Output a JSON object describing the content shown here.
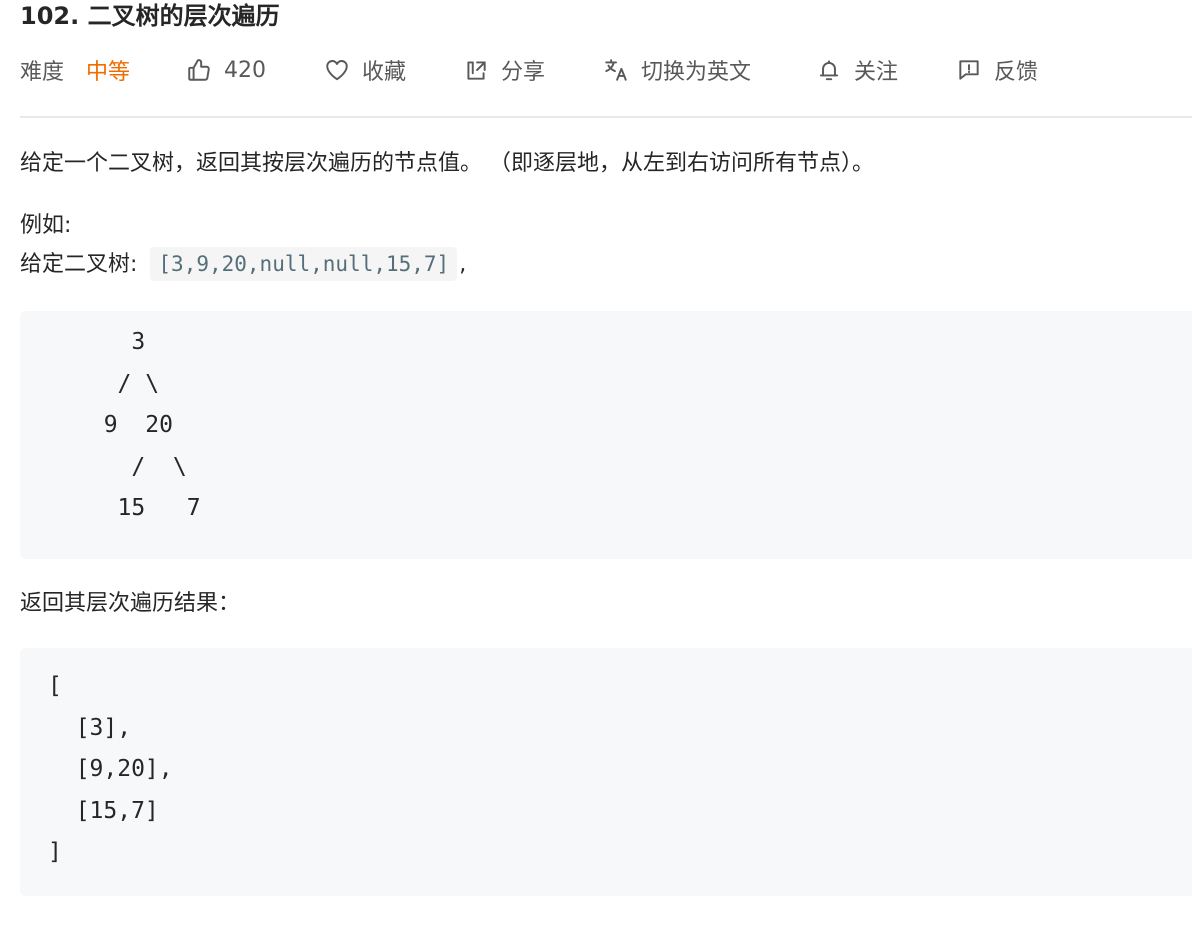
{
  "problem": {
    "title": "102. 二叉树的层次遍历"
  },
  "toolbar": {
    "difficulty_label": "难度",
    "difficulty_value": "中等",
    "likes_count": "420",
    "favorite_label": "收藏",
    "share_label": "分享",
    "translate_label": "切换为英文",
    "follow_label": "关注",
    "feedback_label": "反馈"
  },
  "description": {
    "intro": "给定一个二叉树，返回其按层次遍历的节点值。 （即逐层地，从左到右访问所有节点）。",
    "example_heading": "例如:",
    "given_prefix": "给定二叉树: ",
    "given_code": "[3,9,20,null,null,15,7]",
    "given_suffix": ",",
    "tree_diagram": "    3\n   / \\\n  9  20\n    /  \\\n   15   7",
    "result_heading": "返回其层次遍历结果：",
    "result_code": "[\n  [3],\n  [9,20],\n  [15,7]\n]"
  },
  "colors": {
    "difficulty_medium": "#ef6c00",
    "code_background": "#f7f8fa",
    "inline_code_text": "#546e7a"
  },
  "icons": {
    "likes": "thumbs-up-icon",
    "favorite": "heart-icon",
    "share": "share-icon",
    "translate": "translate-icon",
    "follow": "bell-icon",
    "feedback": "feedback-icon"
  }
}
